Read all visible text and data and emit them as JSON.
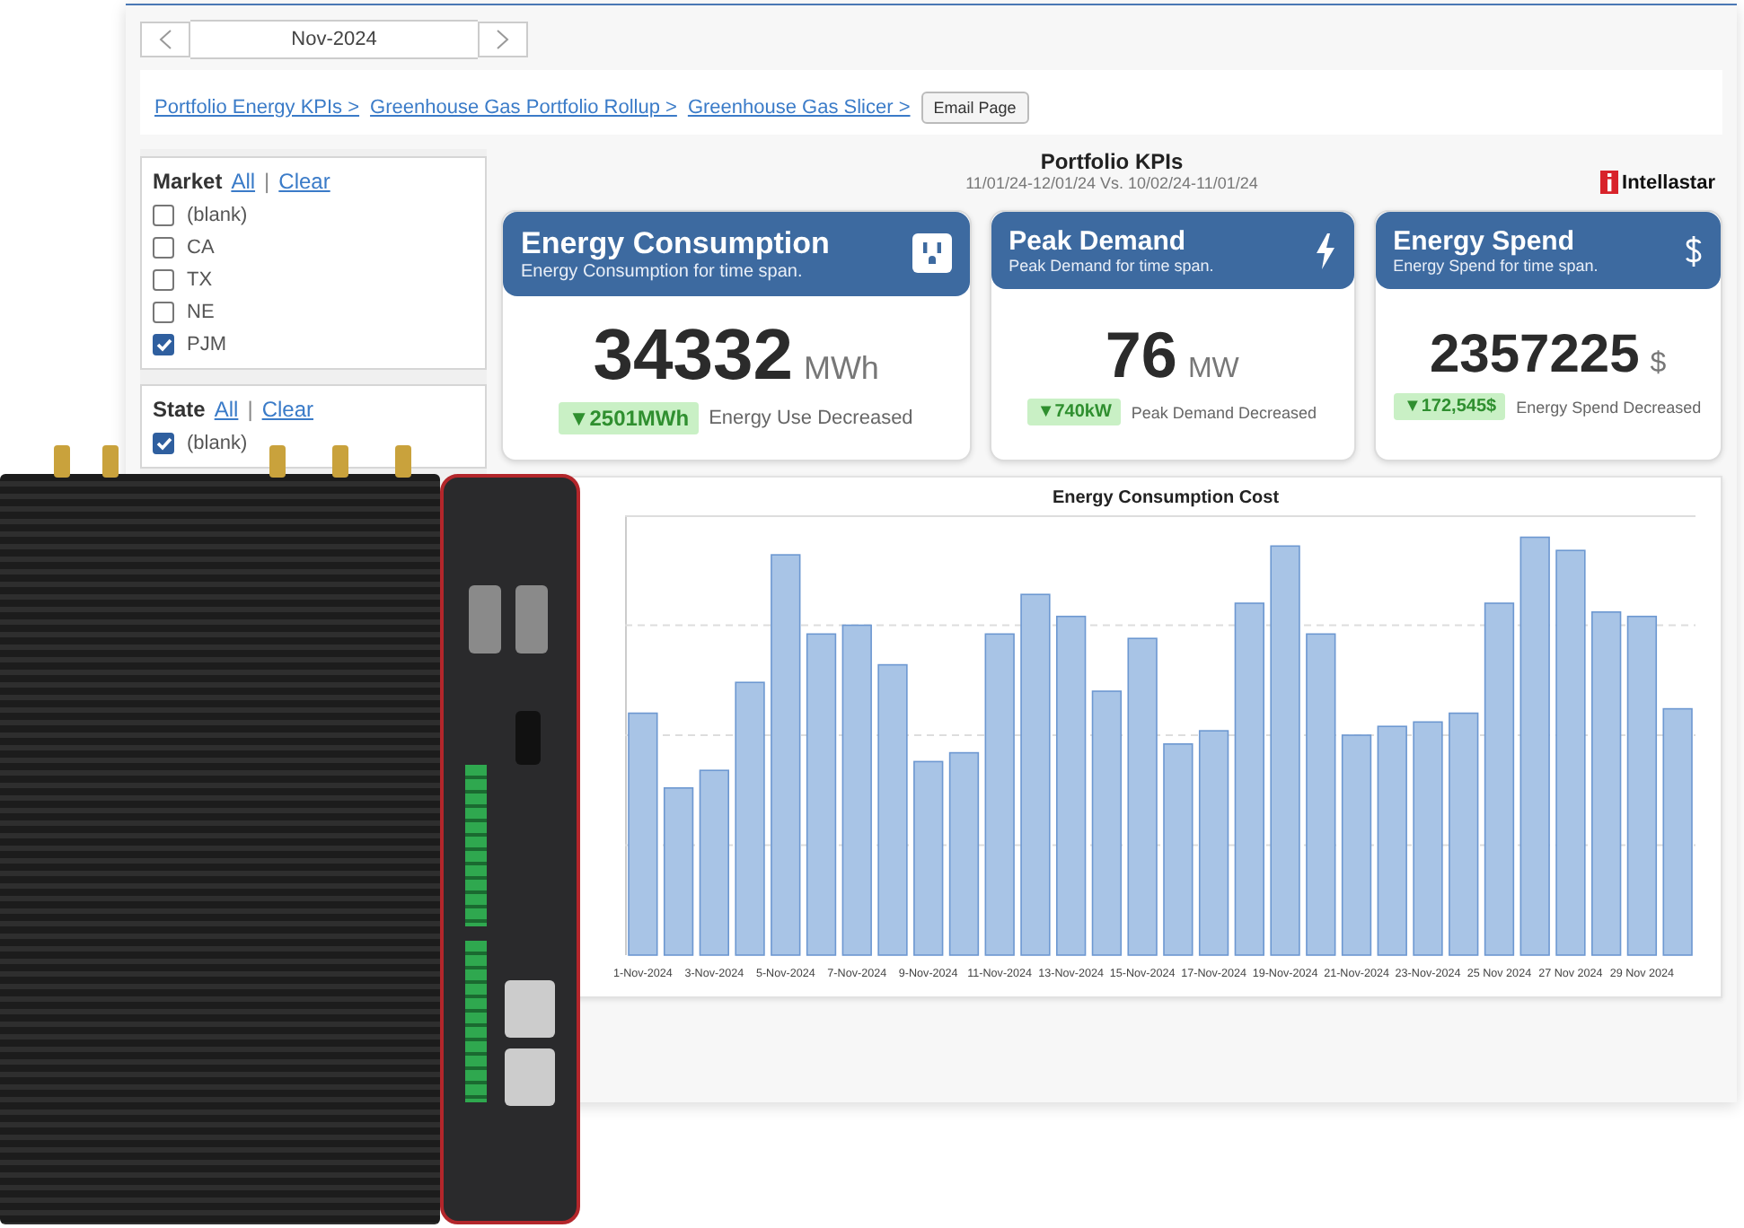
{
  "date_nav": {
    "period": "Nov-2024"
  },
  "breadcrumbs": [
    "Portfolio Energy KPIs >",
    "Greenhouse Gas Portfolio Rollup >",
    "Greenhouse Gas Slicer >"
  ],
  "email_button": "Email Page",
  "header": {
    "title": "Portfolio KPIs",
    "date_range": "11/01/24-12/01/24 Vs. 10/02/24-11/01/24"
  },
  "logo": {
    "text": "Intellastar"
  },
  "filters": [
    {
      "title": "Market",
      "all": "All",
      "separator": "|",
      "clear": "Clear",
      "items": [
        {
          "label": "(blank)",
          "checked": false
        },
        {
          "label": "CA",
          "checked": false
        },
        {
          "label": "TX",
          "checked": false
        },
        {
          "label": "NE",
          "checked": false
        },
        {
          "label": "PJM",
          "checked": true
        }
      ]
    },
    {
      "title": "State",
      "all": "All",
      "separator": "|",
      "clear": "Clear",
      "items": [
        {
          "label": "(blank)",
          "checked": true
        }
      ]
    }
  ],
  "kpis": [
    {
      "title": "Energy Consumption",
      "subtitle": "Energy Consumption for time span.",
      "value": "34332",
      "unit": "MWh",
      "delta": "▼2501MWh",
      "delta_label": "Energy Use Decreased"
    },
    {
      "title": "Peak Demand",
      "subtitle": "Peak Demand for time span.",
      "value": "76",
      "unit": "MW",
      "delta": "▼740kW",
      "delta_label": "Peak Demand Decreased"
    },
    {
      "title": "Energy Spend",
      "subtitle": "Energy Spend for time span.",
      "value": "2357225",
      "unit": "$",
      "delta": "▼172,545$",
      "delta_label": "Energy Spend Decreased"
    }
  ],
  "chart": {
    "title": "Energy Consumption Cost",
    "x_labels": [
      "1-Nov-2024",
      "3-Nov-2024",
      "5-Nov-2024",
      "7-Nov-2024",
      "9-Nov-2024",
      "11-Nov-2024",
      "13-Nov-2024",
      "15-Nov-2024",
      "17-Nov-2024",
      "19-Nov-2024",
      "21-Nov-2024",
      "23-Nov-2024",
      "25 Nov 2024",
      "27 Nov 2024",
      "29 Nov 2024"
    ]
  }
}
